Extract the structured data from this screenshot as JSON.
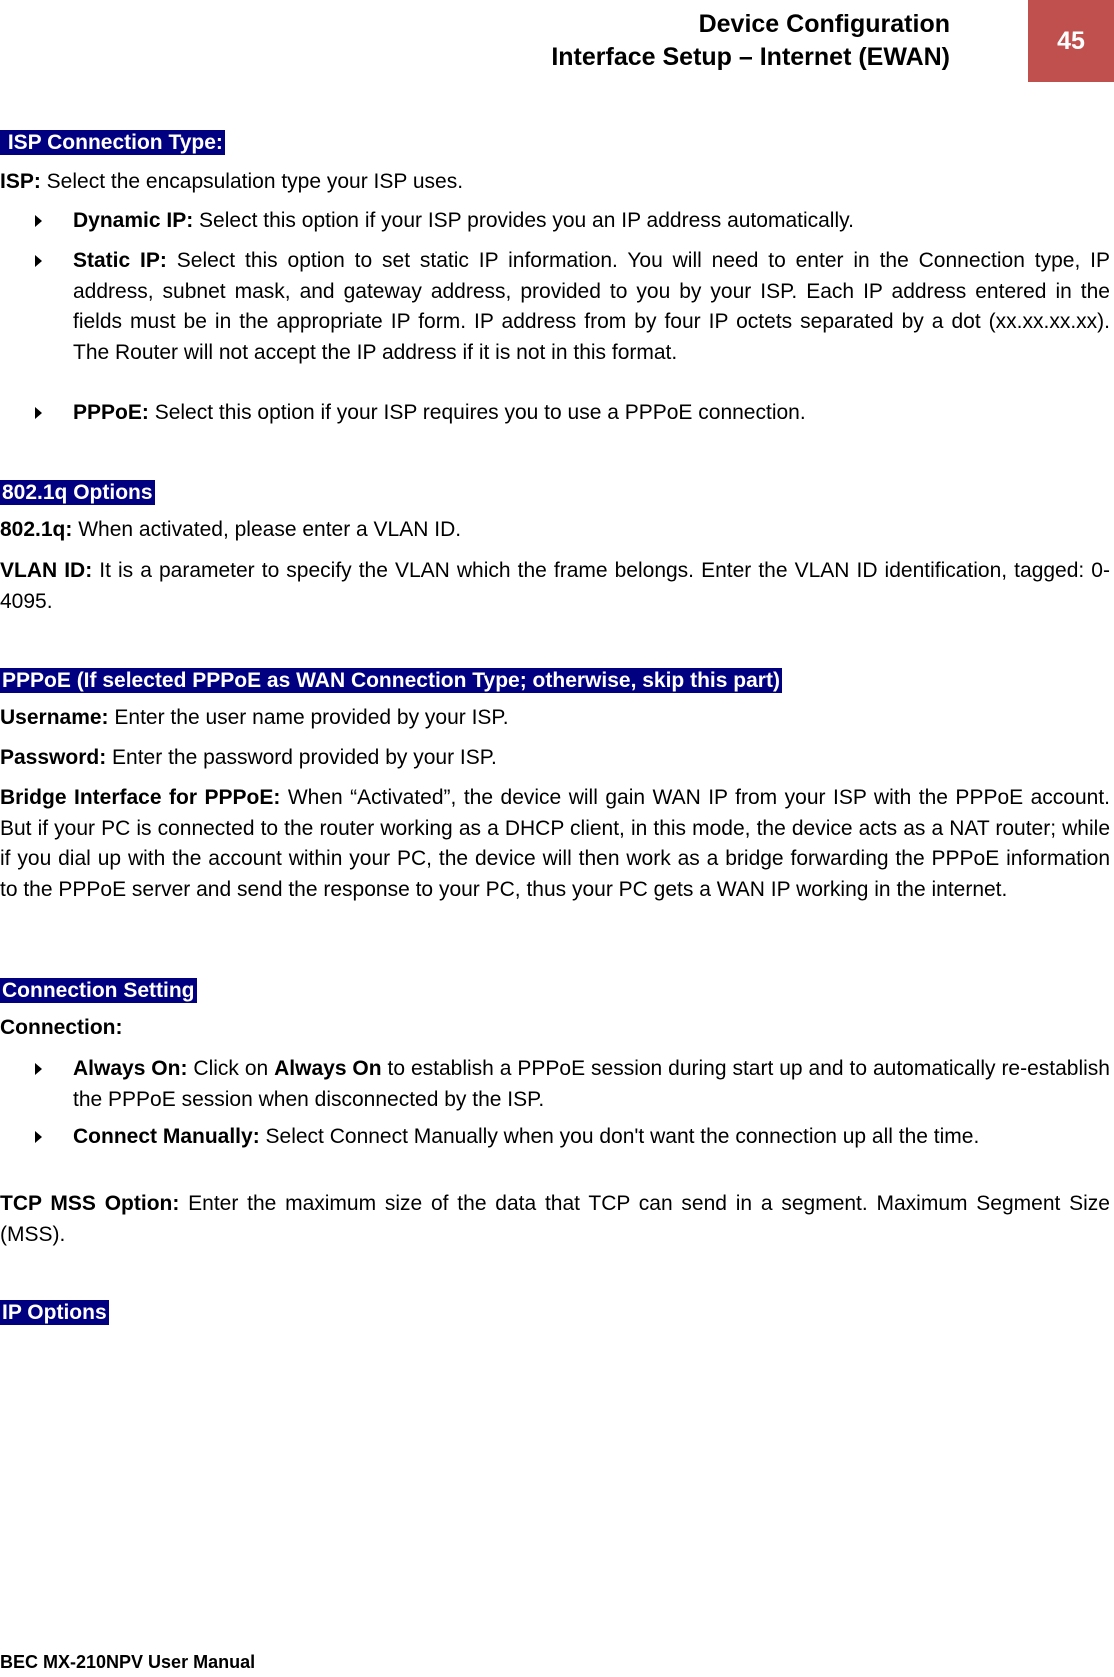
{
  "header": {
    "line1": "Device Configuration",
    "line2": "Interface Setup – Internet (EWAN)",
    "page_number": "45",
    "page_number_color": "#c0504d"
  },
  "heading_color": "#000080",
  "sections": {
    "isp": {
      "heading": " ISP Connection Type:",
      "isp_label": "ISP:",
      "isp_text": " Select the encapsulation type your ISP uses.",
      "bullets": [
        {
          "label": "Dynamic IP:",
          "text": " Select this option if your ISP provides you an IP address automatically."
        },
        {
          "label": "Static IP:",
          "text": " Select this option to set static IP information. You will need to enter in the Connection type, IP address, subnet mask, and gateway address, provided to you by your ISP. Each IP address entered in the fields must be in the appropriate IP form.  IP address from by four IP octets separated by a dot (xx.xx.xx.xx). The Router will not accept the IP address if it is not in this format."
        },
        {
          "label": "PPPoE:",
          "text": " Select this option if your ISP requires you to use a PPPoE connection."
        }
      ]
    },
    "vlan": {
      "heading": "802.1q Options",
      "q_label": "802.1q:",
      "q_text": " When activated, please enter a VLAN ID.",
      "id_label": "VLAN ID:",
      "id_text": " It is a parameter to specify the VLAN which the frame belongs. Enter the VLAN ID identification, tagged: 0-4095."
    },
    "pppoe": {
      "heading": "PPPoE (If selected PPPoE as WAN Connection Type; otherwise, skip this part)",
      "user_label": "Username:",
      "user_text": " Enter the user name provided by your ISP.",
      "pass_label": "Password:",
      "pass_text": " Enter the password provided by your ISP.",
      "bridge_label": "Bridge Interface for PPPoE:",
      "bridge_text": " When “Activated”, the device will gain WAN IP from your ISP with the PPPoE account. But if your PC is connected to the router working as a DHCP client, in this mode, the device acts as a NAT router; while if you dial up with the account within your PC, the device will then work as a bridge forwarding the PPPoE information to the PPPoE server and send the response to your PC, thus your PC gets a WAN IP working in the internet."
    },
    "connection": {
      "heading": "Connection Setting",
      "conn_label": "Connection:",
      "always_label": "Always On:",
      "always_pre": " Click on ",
      "always_bold": "Always On",
      "always_post": " to establish a PPPoE session during start up and to automatically re-establish the PPPoE session when disconnected by the ISP.",
      "manual_label": "Connect Manually:",
      "manual_text": " Select Connect Manually when you don't want the connection up all the time.",
      "mss_label": "TCP MSS Option:",
      "mss_text": " Enter the maximum size of the data that TCP can send in a segment. Maximum Segment Size (MSS)."
    },
    "ip": {
      "heading": "IP Options"
    }
  },
  "footer": {
    "text": "BEC MX-210NPV User Manual"
  }
}
